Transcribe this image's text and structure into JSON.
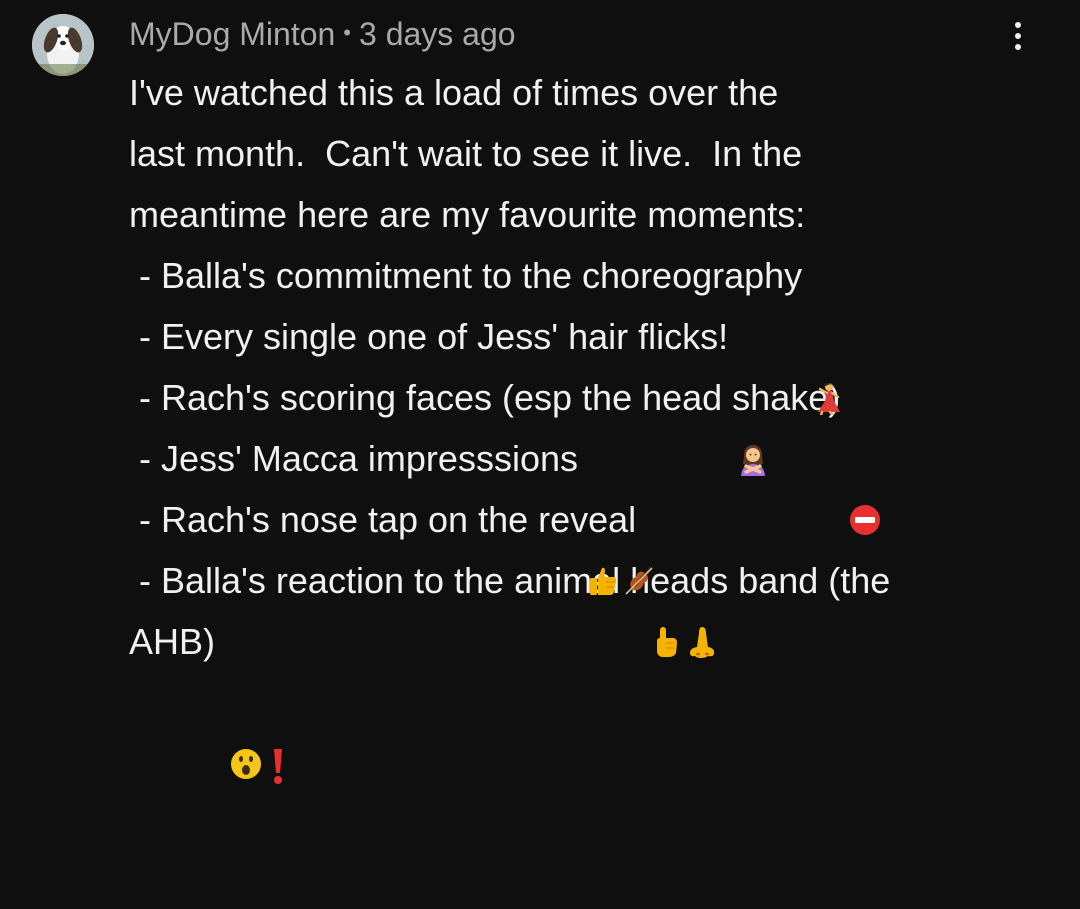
{
  "comment": {
    "author": "MyDog Minton",
    "separator": "•",
    "timestamp": "3 days ago",
    "avatar_icon": "dog-avatar",
    "menu_icon": "more-vert-icon",
    "lines": [
      {
        "text": "I've watched this a load of times over the",
        "emojis": []
      },
      {
        "text": "last month.  Can't wait to see it live.  In the",
        "emojis": []
      },
      {
        "text": "meantime here are my favourite moments:",
        "emojis": []
      },
      {
        "text": " - Balla's commitment to the choreography",
        "emojis": [
          "dancer-emoji"
        ]
      },
      {
        "text": " - Every single one of Jess' hair flicks!",
        "emojis": [
          "person-gesturing-no-emoji"
        ]
      },
      {
        "text": " - Rach's scoring faces (esp the head shake)",
        "emojis": [
          "no-entry-emoji"
        ]
      },
      {
        "text": " - Jess' Macca impresssions",
        "emojis": [
          "thumbs-up-emoji",
          "violin-emoji"
        ]
      },
      {
        "text": " - Rach's nose tap on the reveal",
        "emojis": [
          "pointing-up-emoji",
          "nose-emoji"
        ]
      },
      {
        "text": " - Balla's reaction to the animal heads band (the",
        "emojis": []
      },
      {
        "text": "AHB)",
        "emojis": [
          "astonished-face-emoji",
          "red-exclamation-emoji"
        ]
      }
    ]
  },
  "colors": {
    "background": "#0f0f0f",
    "text_primary": "#f1f1f1",
    "text_secondary": "#aaaaaa"
  }
}
